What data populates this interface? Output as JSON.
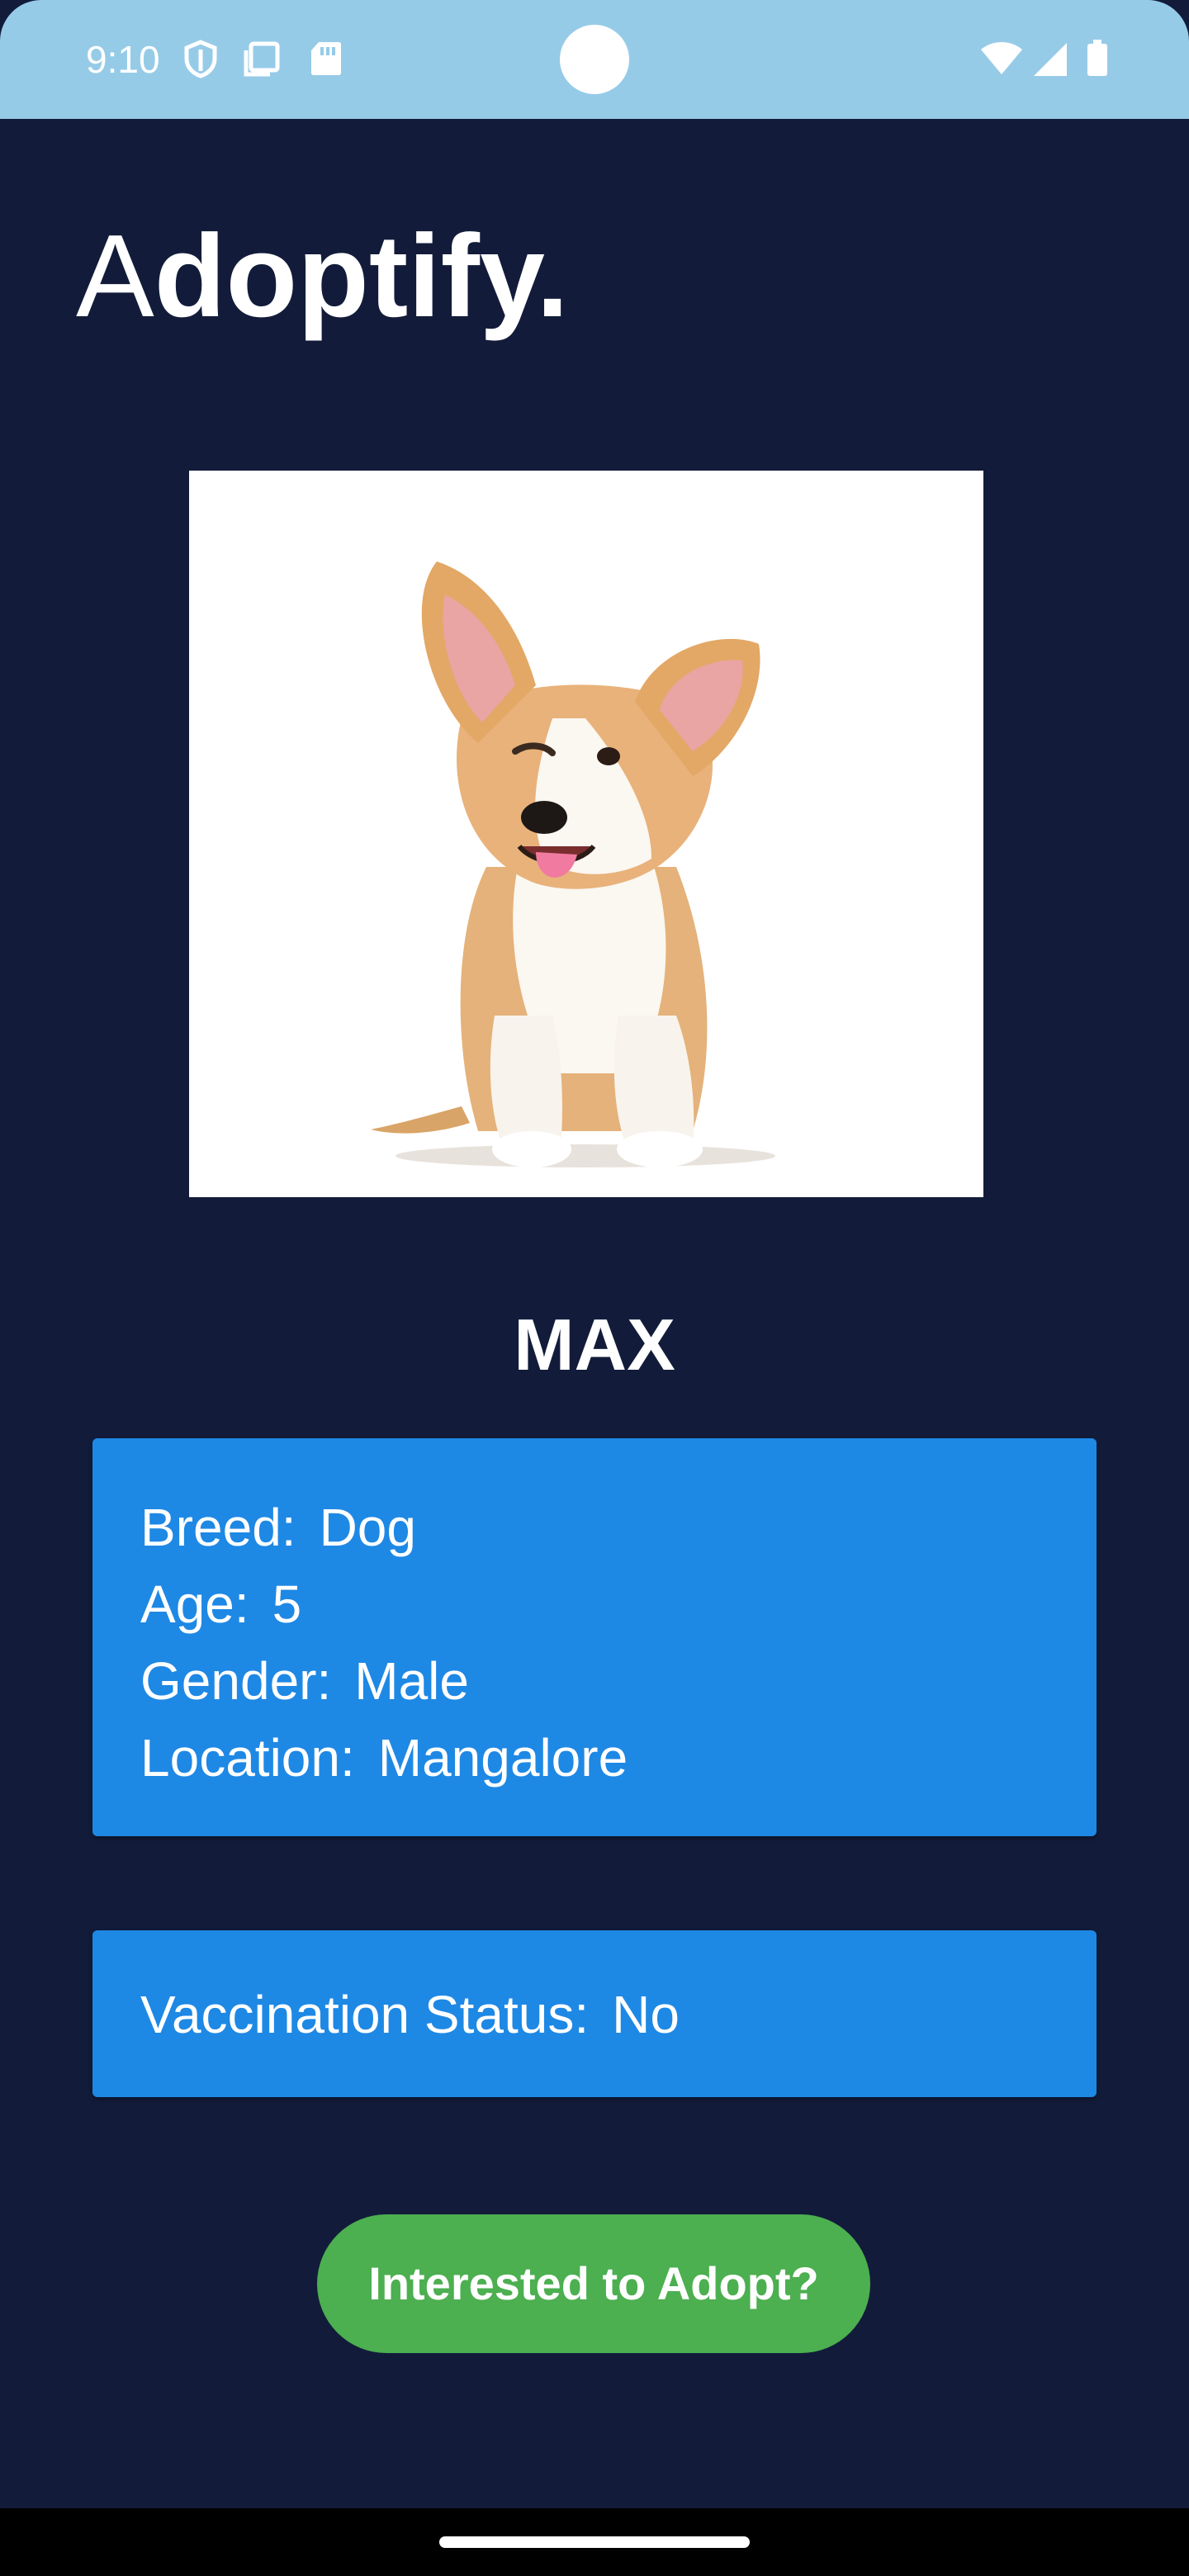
{
  "status_bar": {
    "time": "9:10",
    "icons_left": [
      "shield-icon",
      "clipboard-icon",
      "sd-card-icon"
    ],
    "icons_right": [
      "wifi-icon",
      "signal-icon",
      "battery-icon"
    ]
  },
  "app": {
    "title_first": "A",
    "title_rest": "doptify."
  },
  "pet": {
    "image_icon": "corgi-puppy-photo",
    "name": "MAX",
    "details": [
      {
        "label": "Breed:",
        "value": "Dog"
      },
      {
        "label": "Age:",
        "value": "5"
      },
      {
        "label": "Gender:",
        "value": "Male"
      },
      {
        "label": "Location:",
        "value": "Mangalore"
      }
    ],
    "vaccination": {
      "label": "Vaccination Status:",
      "value": "No"
    }
  },
  "actions": {
    "adopt_label": "Interested to Adopt?"
  },
  "colors": {
    "background": "#121c3a",
    "status_bar": "#96cbe8",
    "card": "#1e88e5",
    "button": "#4caf50"
  }
}
